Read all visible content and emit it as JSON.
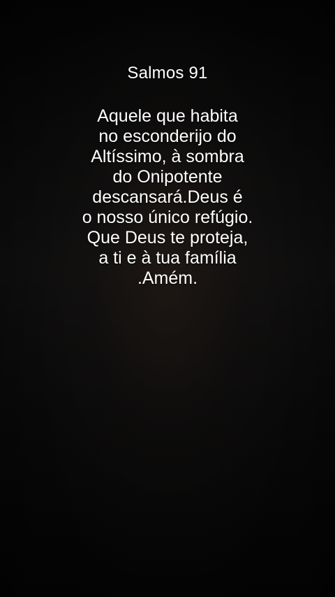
{
  "title": "Salmos 91",
  "verse_lines": [
    "Aquele que habita",
    "no esconderijo do",
    "Altíssimo, à sombra",
    "do Onipotente",
    "descansará.Deus é",
    "o nosso único refúgio.",
    "Que Deus te proteja,",
    "a ti e à tua família",
    ".Amém."
  ],
  "colors": {
    "text": "#ffffff",
    "background": "#070707"
  }
}
